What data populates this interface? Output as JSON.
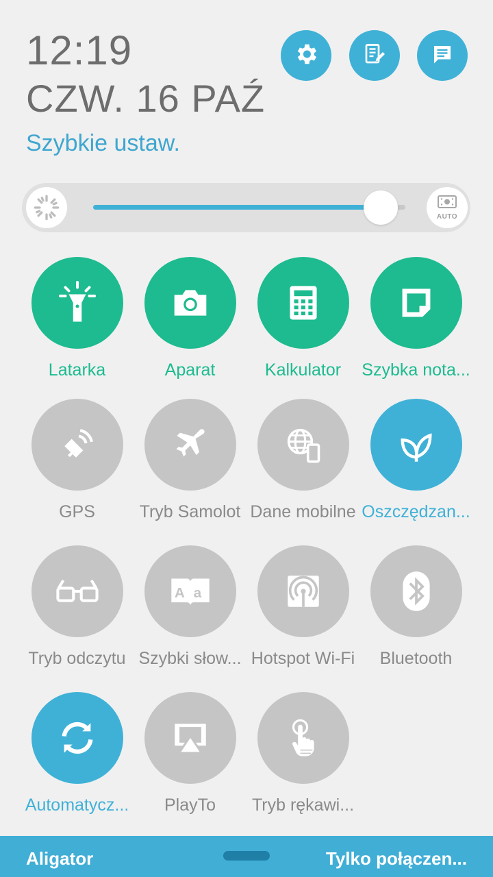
{
  "header": {
    "time": "12:19",
    "date": "CZW. 16 PAŹ",
    "quick_settings_label": "Szybkie ustaw."
  },
  "top_buttons": [
    {
      "icon": "settings-gear-icon"
    },
    {
      "icon": "edit-list-icon"
    },
    {
      "icon": "notifications-list-icon"
    }
  ],
  "brightness": {
    "level_fraction": 0.92,
    "auto_label": "AUTO"
  },
  "colors": {
    "accent_green": "#1dbb8f",
    "accent_blue": "#3fb1d7",
    "inactive_gray": "#c5c5c5",
    "label_inactive": "#8a8a8a",
    "bottom_bar": "#41aed6"
  },
  "tiles": [
    {
      "label": "Latarka",
      "icon": "flashlight-icon",
      "state": "green"
    },
    {
      "label": "Aparat",
      "icon": "camera-icon",
      "state": "green"
    },
    {
      "label": "Kalkulator",
      "icon": "calculator-icon",
      "state": "green"
    },
    {
      "label": "Szybka nota...",
      "icon": "quick-note-icon",
      "state": "green"
    },
    {
      "label": "GPS",
      "icon": "gps-satellite-icon",
      "state": "off"
    },
    {
      "label": "Tryb Samolot",
      "icon": "airplane-icon",
      "state": "off"
    },
    {
      "label": "Dane mobilne",
      "icon": "mobile-data-icon",
      "state": "off"
    },
    {
      "label": "Oszczędzan...",
      "icon": "leaf-icon",
      "state": "on"
    },
    {
      "label": "Tryb odczytu",
      "icon": "reading-glasses-icon",
      "state": "off"
    },
    {
      "label": "Szybki słow...",
      "icon": "dictionary-book-icon",
      "state": "off"
    },
    {
      "label": "Hotspot Wi-Fi",
      "icon": "hotspot-icon",
      "state": "off"
    },
    {
      "label": "Bluetooth",
      "icon": "bluetooth-icon",
      "state": "off"
    },
    {
      "label": "Automatycz...",
      "icon": "sync-icon",
      "state": "on"
    },
    {
      "label": "PlayTo",
      "icon": "playto-icon",
      "state": "off"
    },
    {
      "label": "Tryb rękawi...",
      "icon": "glove-touch-icon",
      "state": "off"
    }
  ],
  "bottom": {
    "carrier": "Aligator",
    "network_status": "Tylko połączen..."
  }
}
